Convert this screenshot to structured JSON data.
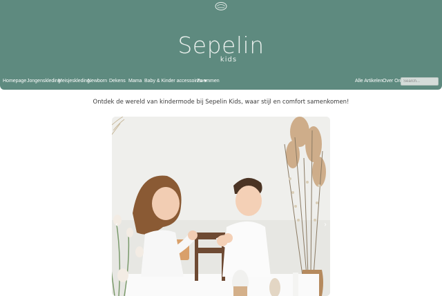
{
  "brand": {
    "name": "Sepelin",
    "sub": "kids",
    "header_color": "#5e8a7f"
  },
  "nav": {
    "items": [
      {
        "label": "Homepage"
      },
      {
        "label": "Jongenskleding"
      },
      {
        "label": "Meisjeskleding"
      },
      {
        "label": "Newborn"
      },
      {
        "label": "Dekens"
      },
      {
        "label": "Mama"
      },
      {
        "label": "Baby & Kinder accessoires",
        "has_dropdown": true
      },
      {
        "label": "Zwemmen"
      }
    ],
    "right_items": [
      {
        "label": "Alle Artikelen"
      },
      {
        "label": "Over Ons"
      }
    ],
    "search_placeholder": "Search..."
  },
  "main": {
    "tagline": "Ontdek de wereld van kindermode bij Sepelin Kids, waar stijl en comfort samenkomen!"
  },
  "hero": {
    "prev_icon": "chevron-left-icon",
    "next_icon": "chevron-right-icon"
  }
}
